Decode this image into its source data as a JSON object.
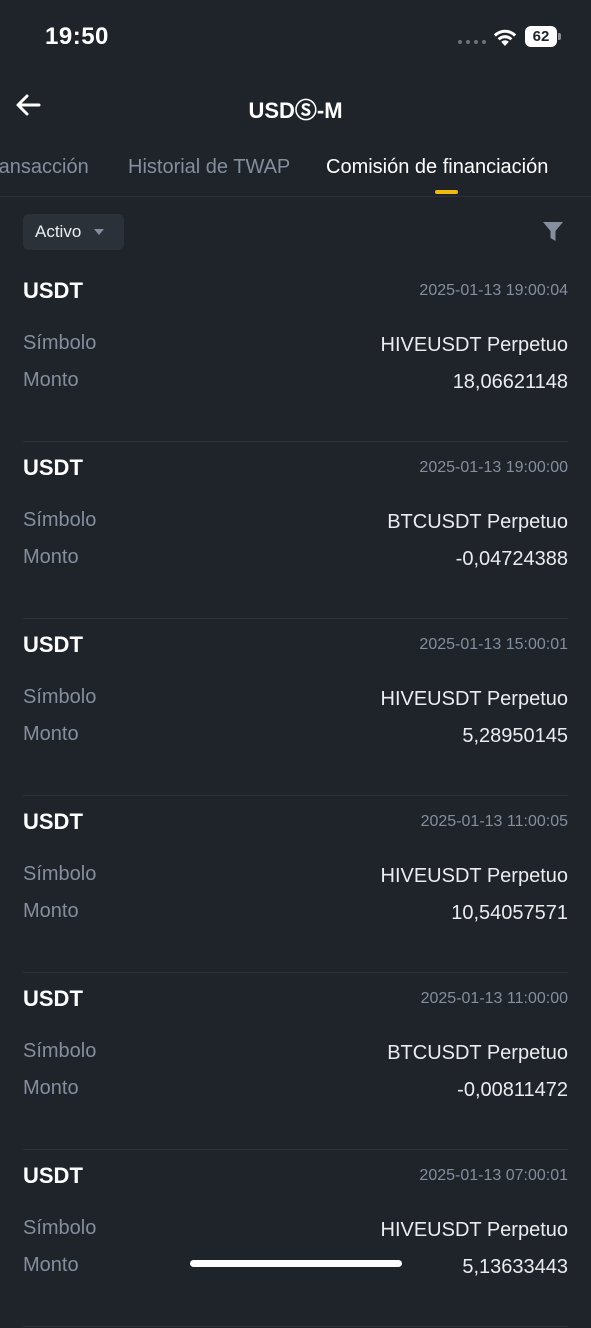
{
  "status_bar": {
    "time": "19:50",
    "battery": "62"
  },
  "header": {
    "title": "USDⓈ-M"
  },
  "tabs": [
    {
      "label": "ransacción"
    },
    {
      "label": "Historial de TWAP"
    },
    {
      "label": "Comisión de financiación",
      "active": true
    }
  ],
  "filter": {
    "status_label": "Activo"
  },
  "labels": {
    "symbol": "Símbolo",
    "amount": "Monto"
  },
  "records": [
    {
      "asset": "USDT",
      "time": "2025-01-13 19:00:04",
      "symbol": "HIVEUSDT Perpetuo",
      "amount": "18,06621148"
    },
    {
      "asset": "USDT",
      "time": "2025-01-13 19:00:00",
      "symbol": "BTCUSDT Perpetuo",
      "amount": "-0,04724388"
    },
    {
      "asset": "USDT",
      "time": "2025-01-13 15:00:01",
      "symbol": "HIVEUSDT Perpetuo",
      "amount": "5,28950145"
    },
    {
      "asset": "USDT",
      "time": "2025-01-13 11:00:05",
      "symbol": "HIVEUSDT Perpetuo",
      "amount": "10,54057571"
    },
    {
      "asset": "USDT",
      "time": "2025-01-13 11:00:00",
      "symbol": "BTCUSDT Perpetuo",
      "amount": "-0,00811472"
    },
    {
      "asset": "USDT",
      "time": "2025-01-13 07:00:01",
      "symbol": "HIVEUSDT Perpetuo",
      "amount": "5,13633443"
    }
  ],
  "colors": {
    "background": "#1f242b",
    "accent": "#f0b90b",
    "muted_text": "#848e9c",
    "primary_text": "#eaecef"
  }
}
